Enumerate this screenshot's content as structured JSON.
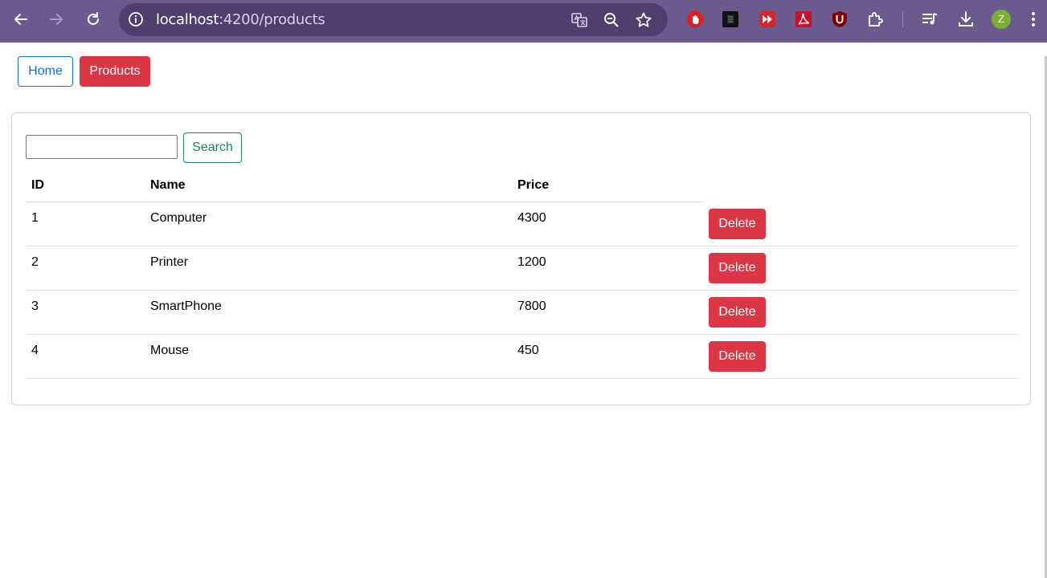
{
  "browser": {
    "url_host": "localhost",
    "url_rest": ":4200/products",
    "profile_initial": "Z",
    "colors": {
      "chrome": "#6b5a8e",
      "omnibox": "#4f3f6d",
      "avatar": "#7cae35"
    }
  },
  "nav": {
    "home_label": "Home",
    "products_label": "Products"
  },
  "search": {
    "input_value": "",
    "button_label": "Search"
  },
  "table": {
    "headers": {
      "id": "ID",
      "name": "Name",
      "price": "Price"
    },
    "delete_label": "Delete",
    "rows": [
      {
        "id": "1",
        "name": "Computer",
        "price": "4300"
      },
      {
        "id": "2",
        "name": "Printer",
        "price": "1200"
      },
      {
        "id": "3",
        "name": "SmartPhone",
        "price": "7800"
      },
      {
        "id": "4",
        "name": "Mouse",
        "price": "450"
      }
    ]
  },
  "colors": {
    "primary": "#0d6efd",
    "danger": "#dc3545",
    "success": "#198754"
  }
}
